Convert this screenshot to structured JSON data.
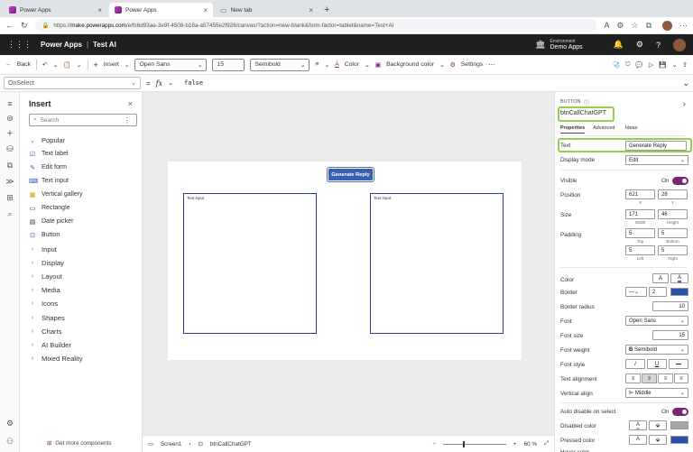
{
  "browser": {
    "tabs": [
      {
        "label": "Power Apps",
        "active": false
      },
      {
        "label": "Power Apps",
        "active": true
      },
      {
        "label": "New tab",
        "active": false
      }
    ],
    "url_prefix": "https://",
    "url_host": "make.powerapps.com",
    "url_path": "/e/fc6d93ae-3e9f-4508-b18a-a57455e2f926/canvas/?action=new-blank&form-factor=tablet&name=Test+AI"
  },
  "header": {
    "app_name": "Power Apps",
    "separator": "|",
    "doc_name": "Test AI",
    "env_label": "Environment",
    "env_value": "Demo Apps"
  },
  "commandbar": {
    "back": "Back",
    "insert": "Insert",
    "font": "Open Sans",
    "font_size": "15",
    "font_weight": "Semibold",
    "color": "Color",
    "bg_color": "Background color",
    "settings": "Settings",
    "more": "⋯"
  },
  "formula": {
    "property": "OnSelect",
    "eq": "=",
    "fx": "fx",
    "value": "false"
  },
  "insert_panel": {
    "title": "Insert",
    "search_placeholder": "Search",
    "popular": "Popular",
    "items": [
      {
        "label": "Text label",
        "icon": "text-label-icon"
      },
      {
        "label": "Edit form",
        "icon": "edit-form-icon"
      },
      {
        "label": "Text input",
        "icon": "text-input-icon"
      },
      {
        "label": "Vertical gallery",
        "icon": "gallery-icon"
      },
      {
        "label": "Rectangle",
        "icon": "rectangle-icon"
      },
      {
        "label": "Date picker",
        "icon": "date-picker-icon"
      },
      {
        "label": "Button",
        "icon": "button-icon"
      }
    ],
    "categories": [
      "Input",
      "Display",
      "Layout",
      "Media",
      "Icons",
      "Shapes",
      "Charts",
      "AI Builder",
      "Mixed Reality"
    ],
    "get_more": "Get more components"
  },
  "canvas": {
    "button_text": "Generate Reply",
    "input_left_text": "Text input",
    "input_right_text": "Text input"
  },
  "statusbar": {
    "screen": "Screen1",
    "control": "btnCallChatGPT",
    "zoom": "60 %",
    "minus": "−",
    "plus": "+"
  },
  "properties": {
    "type_label": "BUTTON",
    "control_name": "btnCallChatGPT",
    "tabs": [
      "Properties",
      "Advanced",
      "Ideas"
    ],
    "text_label": "Text",
    "text_value": "Generate Reply",
    "display_mode_label": "Display mode",
    "display_mode_value": "Edit",
    "visible_label": "Visible",
    "visible_value": "On",
    "position_label": "Position",
    "pos_x": "621",
    "pos_y": "28",
    "x_lbl": "X",
    "y_lbl": "Y",
    "size_label": "Size",
    "width": "171",
    "height": "46",
    "width_lbl": "Width",
    "height_lbl": "Height",
    "padding_label": "Padding",
    "pad_top": "5",
    "pad_bottom": "5",
    "pad_left": "5",
    "pad_right": "5",
    "top_lbl": "Top",
    "bottom_lbl": "Bottom",
    "left_lbl": "Left",
    "right_lbl": "Right",
    "color_label": "Color",
    "border_label": "Border",
    "border_width": "2",
    "border_radius_label": "Border radius",
    "border_radius": "10",
    "font_label": "Font",
    "font_value": "Open Sans",
    "font_size_label": "Font size",
    "font_size_value": "15",
    "font_weight_label": "Font weight",
    "font_weight_value": "Semibold",
    "font_style_label": "Font style",
    "text_align_label": "Text alignment",
    "valign_label": "Vertical align",
    "valign_value": "Middle",
    "auto_disable_label": "Auto disable on select",
    "auto_disable_value": "On",
    "disabled_color_label": "Disabled color",
    "pressed_color_label": "Pressed color",
    "hover_color_label": "Hover color"
  },
  "colors": {
    "accent": "#742774",
    "button_fill": "#3860b2",
    "highlight": "#92d050",
    "header_bg": "#1f1f1f"
  }
}
